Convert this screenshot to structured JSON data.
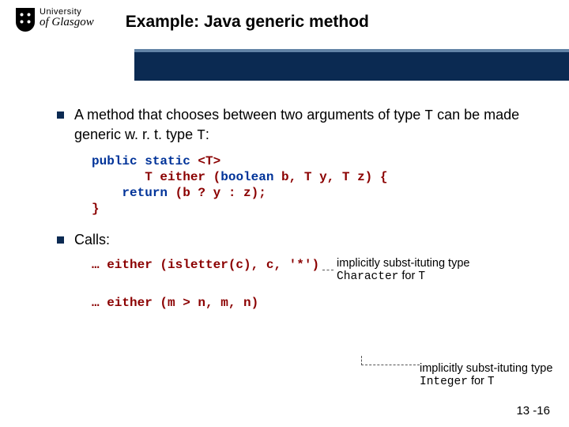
{
  "logo": {
    "top": "University",
    "bottom": "of Glasgow"
  },
  "title": "Example: Java generic method",
  "bullets": {
    "b1a": "A method that chooses between two arguments of type ",
    "b1_t1": "T",
    "b1b": " can be made generic w. r. t. type ",
    "b1_t2": "T",
    "b1c": ":",
    "b2": "Calls:"
  },
  "code": {
    "kw_public": "public",
    "kw_static": "static",
    "angleT": " <T>",
    "line2a": "       T either (",
    "kw_bool": "boolean",
    "line2b": " b, T y, T z) {",
    "line3a": "    ",
    "kw_return": "return",
    "line3b": " (b ? y : z);",
    "line4": "}"
  },
  "calls": {
    "c1": "… either (isletter(c), c, '*')",
    "c2": "… either (m > n, m, n)"
  },
  "notes": {
    "n1a": "implicitly subst-ituting type ",
    "n1b": "Character",
    "n1c": " for ",
    "n1d": "T",
    "n2a": "implicitly subst-ituting type ",
    "n2b": "Integer",
    "n2c": " for ",
    "n2d": "T"
  },
  "pagenum": "13 -16"
}
